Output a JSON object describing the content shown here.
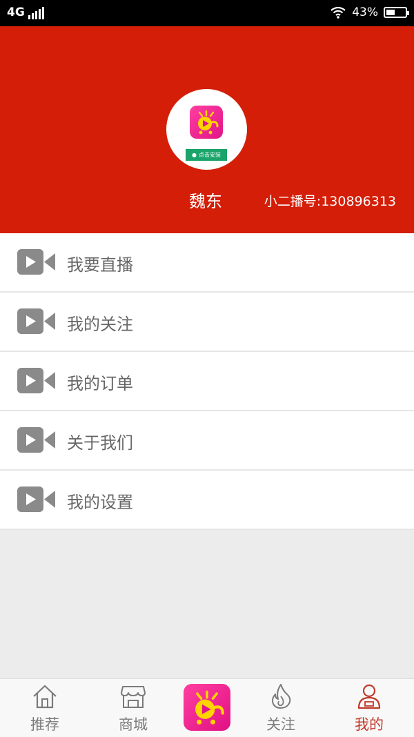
{
  "status_bar": {
    "network": "4G",
    "battery_percent": "43%"
  },
  "profile": {
    "install_tag": "点击安装",
    "username": "魏东",
    "user_id": "小二播号:130896313"
  },
  "menu": {
    "items": [
      {
        "label": "我要直播",
        "icon": "video-camera-icon"
      },
      {
        "label": "我的关注",
        "icon": "video-camera-icon"
      },
      {
        "label": "我的订单",
        "icon": "video-camera-icon"
      },
      {
        "label": "关于我们",
        "icon": "video-camera-icon"
      },
      {
        "label": "我的设置",
        "icon": "video-camera-icon"
      }
    ]
  },
  "bottom_nav": {
    "items": [
      {
        "label": "推荐",
        "icon": "home-icon",
        "active": false
      },
      {
        "label": "商城",
        "icon": "shop-icon",
        "active": false
      },
      {
        "label": "",
        "icon": "app-logo-icon",
        "active": false
      },
      {
        "label": "关注",
        "icon": "flame-icon",
        "active": false
      },
      {
        "label": "我的",
        "icon": "person-icon",
        "active": true
      }
    ]
  },
  "colors": {
    "header_red": "#d41e07",
    "active_tab": "#c0392b",
    "logo_pink": "#e0148a",
    "install_green": "#1aa36a"
  }
}
